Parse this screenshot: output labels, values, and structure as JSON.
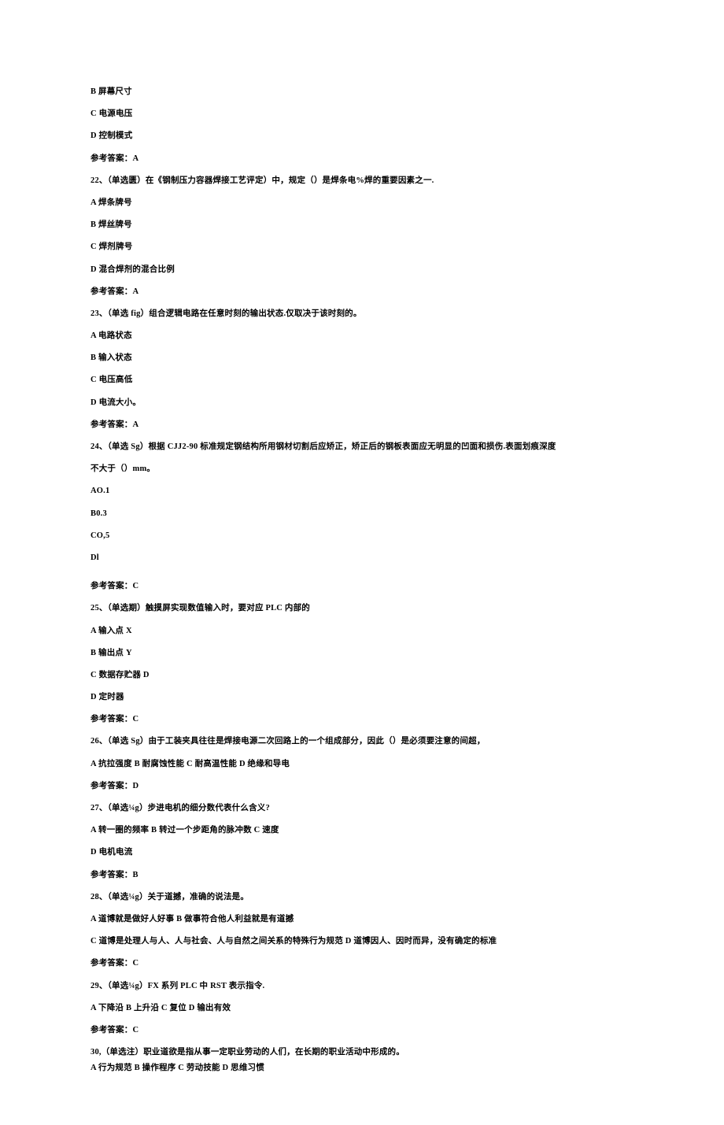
{
  "pre": [
    "B 屏幕尺寸",
    "C 电源电压",
    "D 控制模式",
    "参考答案：A"
  ],
  "q22": {
    "stem_a": "22、（单选匮）在《钢制压力容器焊接工艺评定）中，规定（）是焊条电%焊的重要因素之一.",
    "optA": "A 焊条牌号",
    "optB": "B 焊丝牌号",
    "optC": "C 焊剂牌号",
    "optD": "D 混合焊剂的混合比例",
    "ans": "参考答案：A"
  },
  "q23": {
    "stem": "23、（单选 fig）组合逻辑电路在任意时刻的输出状态.仅取决于该时刻的。",
    "optA": "A 电路状态",
    "optB": "B 输入状态",
    "optC": "C 电压高低",
    "optD": "D 电流大小。",
    "ans": "参考答案：A"
  },
  "q24": {
    "stem1": "24、（单选 Sg）根据 CJJ2-90 标准规定钢结构所用钢材切割后应矫正，矫正后的钢板表面应无明显的凹面和损伤.表面划痕深度",
    "stem2": "不大于（）mm。",
    "optA": "AO.1",
    "optB": "B0.3",
    "optC": "CO,5",
    "optD": "Dl",
    "ans": "参考答案：C"
  },
  "q25": {
    "stem": "25、（单选期）触摸屏实现数值输入时，要对应 PLC 内部的",
    "optA": "A 输入点 X",
    "optB": "B 输出点 Y",
    "optC": "C 数据存贮器 D",
    "optD": "D 定时器",
    "ans": "参考答案：C"
  },
  "q26": {
    "stem": "26、（单选 Sg）由于工装夹具往往是焊接电源二次回路上的一个组成部分，因此（）是必须要注意的间超，",
    "opts": "A 抗拉强度 B 耐腐蚀性能 C 耐高温性能 D 绝缘和导电",
    "ans": "参考答案：D"
  },
  "q27": {
    "stem": "27、（单选¼g）步进电机的细分数代表什么含义?",
    "opts1": "A 转一圈的频率 B 转过一个步距角的脉冲数 C 速度",
    "opts2": "D 电机电流",
    "ans": "参考答案：B"
  },
  "q28": {
    "stem": "28、（单选¼g）关于道撼，准确的说法是。",
    "opts1": "A 道博就是做好人好事 B 做事符合他人利益就是有道撼",
    "opts2": "C 道博是处理人与人、人与社会、人与自然之间关系的特殊行为规范 D 道博因人、因时而异，没有确定的标准",
    "ans": "参考答案：C"
  },
  "q29": {
    "stem": "29、（单选¼g）FX 系列 PLC 中 RST 表示指令.",
    "opts": "A 下降沿 B 上升沿 C 复位 D 输出有效",
    "ans": "参考答案：C"
  },
  "q30": {
    "stem": "30,（单选注）职业道欲是指从事一定职业劳动的人们，在长期的职业活动中形成的。",
    "opts": "A 行为规范 B 操作程序 C 劳动技能 D 思维习惯"
  }
}
